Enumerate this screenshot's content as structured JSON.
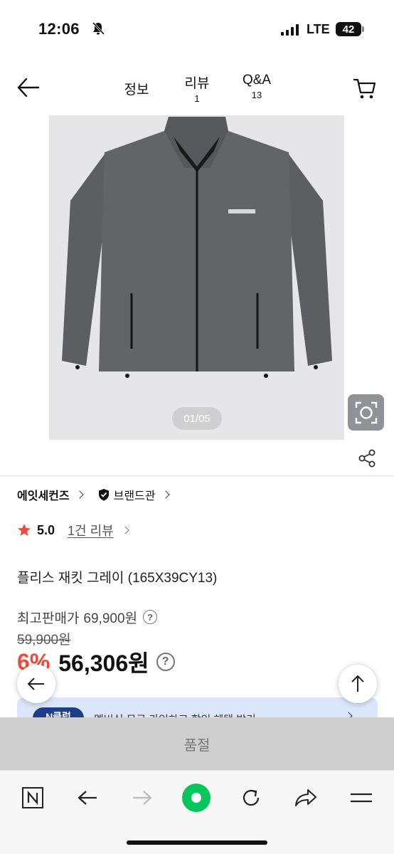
{
  "status_bar": {
    "time": "12:06",
    "network": "LTE",
    "battery": "42"
  },
  "header": {
    "tabs": [
      {
        "label": "정보",
        "count": ""
      },
      {
        "label": "리뷰",
        "count": "1"
      },
      {
        "label": "Q&A",
        "count": "13"
      }
    ],
    "icons": {
      "back": "arrow-left-icon",
      "cart": "shopping-cart-icon"
    }
  },
  "gallery": {
    "page_indicator": "01/05",
    "current_page": 1,
    "total_pages": 5,
    "lens_icon": "camera-lens-icon",
    "share_icon": "share-icon"
  },
  "product": {
    "brand_name": "에잇세컨즈",
    "brand_shop_label": "브랜드관",
    "rating": "5.0",
    "review_link": "1건 리뷰",
    "title": "플리스 재킷 그레이 (165X39CY13)",
    "max_price_label": "최고판매가",
    "max_price": "69,900원",
    "original_price": "59,900원",
    "discount": "6%",
    "sale_price": "56,306원"
  },
  "promo": {
    "badge": "N클럽",
    "text": "멤버십 무료 가입하고 할인 혜택 받기"
  },
  "buy_bar": {
    "label": "품절"
  },
  "colors": {
    "discount_red": "#f1493b",
    "star_red": "#f1493b",
    "naver_green": "#03c75a",
    "soldout_gray": "#cfcfd0",
    "promo_blue": "#dbe6fb"
  }
}
